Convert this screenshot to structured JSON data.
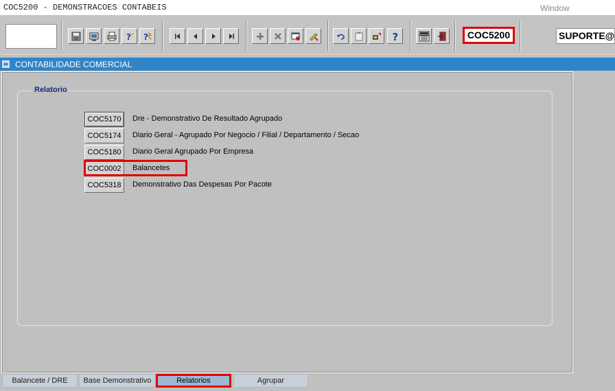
{
  "window": {
    "title": "COC5200 - DEMONSTRACOES CONTABEIS",
    "menu_window": "Window"
  },
  "toolbar": {
    "form_code": "COC5200",
    "user": "SUPORTE@",
    "buttons": [
      {
        "name": "save-icon"
      },
      {
        "name": "screen-icon"
      },
      {
        "name": "print-icon"
      },
      {
        "name": "help-query-icon"
      },
      {
        "name": "execute-query-icon"
      },
      {
        "name": "first-record-icon"
      },
      {
        "name": "previous-record-icon"
      },
      {
        "name": "next-record-icon"
      },
      {
        "name": "last-record-icon"
      },
      {
        "name": "insert-record-icon"
      },
      {
        "name": "delete-record-icon"
      },
      {
        "name": "duplicate-icon"
      },
      {
        "name": "edit-icon"
      },
      {
        "name": "undo-icon"
      },
      {
        "name": "clipboard-icon"
      },
      {
        "name": "tools-icon"
      },
      {
        "name": "help-icon"
      },
      {
        "name": "menu-icon"
      },
      {
        "name": "exit-icon"
      }
    ]
  },
  "module": {
    "title": "CONTABILIDADE COMERCIAL"
  },
  "group": {
    "label": "Relatorio",
    "reports": [
      {
        "code": "COC5170",
        "label": "Dre - Demonstrativo De Resultado Agrupado"
      },
      {
        "code": "COC5174",
        "label": "Diario Geral - Agrupado Por Negocio / Filial / Departamento / Secao"
      },
      {
        "code": "COC5180",
        "label": "Diario Geral Agrupado Por Empresa"
      },
      {
        "code": "COC0002",
        "label": "Balancetes"
      },
      {
        "code": "COC5318",
        "label": "Demonstrativo Das Despesas Por Pacote"
      }
    ]
  },
  "tabs": [
    {
      "label": "Balancete / DRE"
    },
    {
      "label": "Base Demonstrativo"
    },
    {
      "label": "Relatorios"
    },
    {
      "label": "Agrupar"
    }
  ],
  "colors": {
    "header_blue": "#2f85c8",
    "highlight_red": "#e00000",
    "group_label": "#1b2a80"
  }
}
